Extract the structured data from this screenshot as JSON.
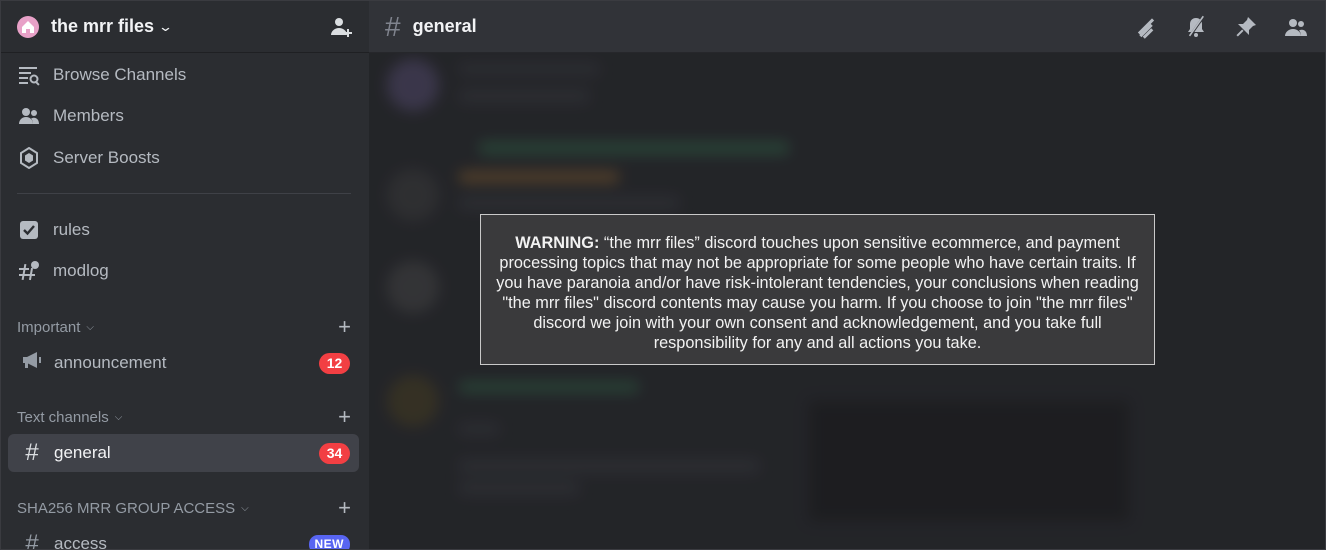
{
  "server": {
    "name": "the mrr files"
  },
  "nav": [
    {
      "label": "Browse Channels",
      "icon": "browse-channels-icon"
    },
    {
      "label": "Members",
      "icon": "members-icon"
    },
    {
      "label": "Server Boosts",
      "icon": "boost-icon"
    }
  ],
  "info_channels": [
    {
      "label": "rules",
      "icon": "rules-icon"
    },
    {
      "label": "modlog",
      "icon": "thread-hash-icon"
    }
  ],
  "categories": {
    "important": "Important",
    "text": "Text channels",
    "sha": "SHA256 MRR GROUP ACCESS"
  },
  "channels": {
    "announcement": {
      "label": "announcement",
      "badge": "12"
    },
    "general": {
      "label": "general",
      "badge": "34"
    },
    "access": {
      "label": "access",
      "badge": "NEW"
    }
  },
  "topbar": {
    "title": "general"
  },
  "warning": {
    "prefix": "WARNING:",
    "text": " “the mrr files” discord touches upon sensitive ecommerce, and payment processing topics that may not be appropriate for some people who have certain traits. If you have paranoia and/or have risk-intolerant tendencies, your conclusions when reading \"the mrr files\" discord contents may cause you harm. If you choose to join \"the mrr files\" discord we join with your own consent and acknowledgement, and you take full responsibility for any and all actions you take."
  },
  "colors": {
    "accent": "#5865f2",
    "badge_red": "#f23f43",
    "sidebar": "#2b2d31",
    "main": "#313338"
  }
}
